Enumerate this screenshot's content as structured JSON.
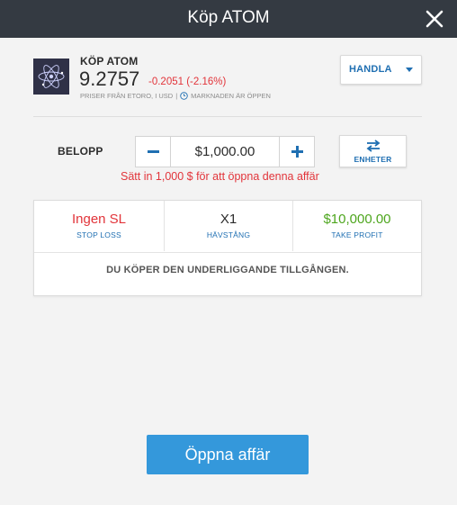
{
  "header": {
    "title": "Köp ATOM"
  },
  "asset": {
    "action": "KÖP",
    "symbol": "ATOM",
    "price": "9.2757",
    "change": "-0.2051 (-2.16%)",
    "price_source": "PRISER FRÅN ETORO, I USD",
    "separator": "|",
    "market_status": "MARKNADEN ÄR ÖPPEN",
    "logo_icon": "atom-logo-icon"
  },
  "trade_menu": {
    "label": "HANDLA"
  },
  "amount": {
    "label": "BELOPP",
    "value": "$1,000.00",
    "warning": "Sätt in 1,000 $ för att öppna denna affär"
  },
  "units_button": {
    "label": "ENHETER"
  },
  "parameters": {
    "stop_loss": {
      "value": "Ingen SL",
      "label": "STOP LOSS"
    },
    "leverage": {
      "value": "X1",
      "label": "HÄVSTÅNG"
    },
    "take_profit": {
      "value": "$10,000.00",
      "label": "TAKE PROFIT"
    },
    "note": "DU KÖPER DEN UNDERLIGGANDE TILLGÅNGEN."
  },
  "open_button": {
    "label": "Öppna affär"
  },
  "colors": {
    "header_bg": "#343a42",
    "accent_blue": "#1f6fb2",
    "primary_button": "#3498db",
    "negative_red": "#e2343a",
    "positive_green": "#4ea61e"
  }
}
